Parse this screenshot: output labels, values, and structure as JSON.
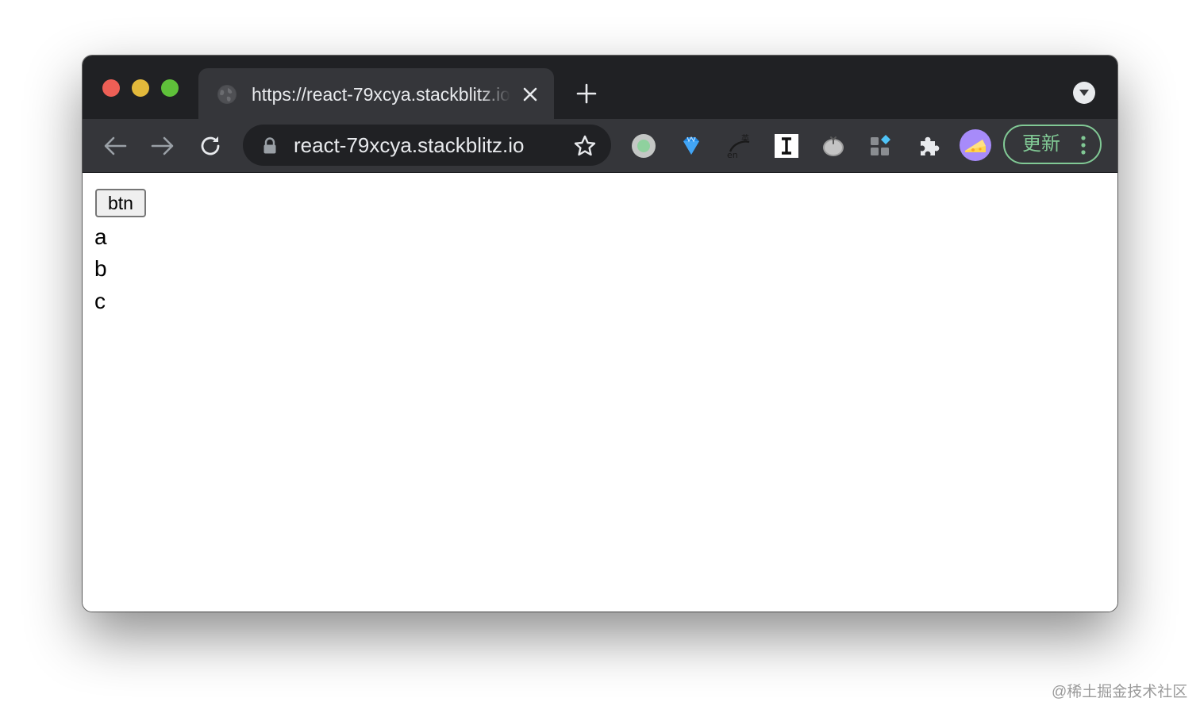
{
  "browser": {
    "tab": {
      "title": "https://react-79xcya.stackblitz.io",
      "favicon": "globe-icon"
    },
    "address_bar": {
      "url": "react-79xcya.stackblitz.io",
      "security_icon": "lock-icon"
    },
    "extensions": [
      "circle-extension-icon",
      "gem-extension-icon",
      "translate-extension-icon",
      "instapaper-extension-icon",
      "tomato-extension-icon",
      "apps-extension-icon",
      "puzzle-extensions-icon"
    ],
    "profile_avatar": "cheese-avatar-icon",
    "update_button": {
      "label": "更新"
    },
    "colors": {
      "tabstrip": "#202124",
      "toolbar": "#35363a",
      "update_accent": "#81c995"
    }
  },
  "page": {
    "button_label": "btn",
    "list": [
      "a",
      "b",
      "c"
    ]
  },
  "watermark": "@稀土掘金技术社区"
}
